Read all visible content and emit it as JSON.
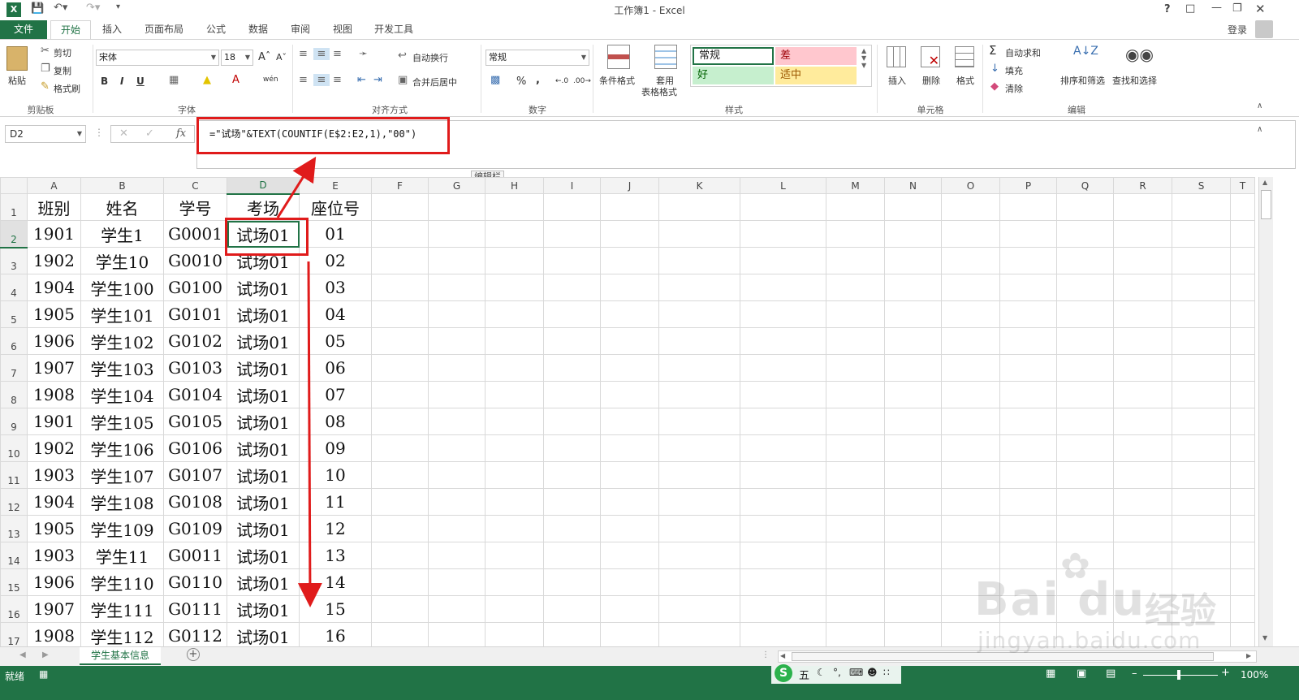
{
  "window": {
    "title": "工作簿1 - Excel",
    "help": "?",
    "sign_in": "登录",
    "undo_icon": "undo-icon",
    "redo_icon": "redo-icon"
  },
  "tabs": [
    "文件",
    "开始",
    "插入",
    "页面布局",
    "公式",
    "数据",
    "审阅",
    "视图",
    "开发工具"
  ],
  "active_tab": "开始",
  "ribbon": {
    "clipboard": {
      "paste": "粘贴",
      "cut": "剪切",
      "copy": "复制",
      "format_painter": "格式刷",
      "group": "剪贴板"
    },
    "font": {
      "name": "宋体",
      "size": "18",
      "bold": "B",
      "italic": "I",
      "underline": "U",
      "font_color": "A",
      "phonetic": "wén",
      "group": "字体"
    },
    "alignment": {
      "wrap": "自动换行",
      "merge": "合并后居中",
      "group": "对齐方式"
    },
    "number": {
      "format": "常规",
      "percent": "%",
      "comma": ",",
      "group": "数字"
    },
    "styles": {
      "conditional": "条件格式",
      "table_top": "套用",
      "table_bottom": "表格格式",
      "normal": "常规",
      "bad": "差",
      "good": "好",
      "neutral": "适中",
      "group": "样式"
    },
    "cells": {
      "insert": "插入",
      "delete": "删除",
      "format": "格式",
      "group": "单元格"
    },
    "editing": {
      "autosum": "自动求和",
      "fill": "填充",
      "clear": "清除",
      "sort": "排序和筛选",
      "find": "查找和选择",
      "group": "编辑"
    }
  },
  "formula_bar": {
    "name_box": "D2",
    "formula": "=\"试场\"&TEXT(COUNTIF(E$2:E2,1),\"00\")",
    "tooltip": "编辑栏"
  },
  "columns": [
    "A",
    "B",
    "C",
    "D",
    "E",
    "F",
    "G",
    "H",
    "I",
    "J",
    "K",
    "L",
    "M",
    "N",
    "O",
    "P",
    "Q",
    "R",
    "S",
    "T"
  ],
  "selected_cell": "D2",
  "rows": [
    {
      "n": "1",
      "cells": [
        "班别",
        "姓名",
        "学号",
        "考场",
        "座位号"
      ]
    },
    {
      "n": "2",
      "cells": [
        "1901",
        "学生1",
        "G0001",
        "试场01",
        "01"
      ]
    },
    {
      "n": "3",
      "cells": [
        "1902",
        "学生10",
        "G0010",
        "试场01",
        "02"
      ]
    },
    {
      "n": "4",
      "cells": [
        "1904",
        "学生100",
        "G0100",
        "试场01",
        "03"
      ]
    },
    {
      "n": "5",
      "cells": [
        "1905",
        "学生101",
        "G0101",
        "试场01",
        "04"
      ]
    },
    {
      "n": "6",
      "cells": [
        "1906",
        "学生102",
        "G0102",
        "试场01",
        "05"
      ]
    },
    {
      "n": "7",
      "cells": [
        "1907",
        "学生103",
        "G0103",
        "试场01",
        "06"
      ]
    },
    {
      "n": "8",
      "cells": [
        "1908",
        "学生104",
        "G0104",
        "试场01",
        "07"
      ]
    },
    {
      "n": "9",
      "cells": [
        "1901",
        "学生105",
        "G0105",
        "试场01",
        "08"
      ]
    },
    {
      "n": "10",
      "cells": [
        "1902",
        "学生106",
        "G0106",
        "试场01",
        "09"
      ]
    },
    {
      "n": "11",
      "cells": [
        "1903",
        "学生107",
        "G0107",
        "试场01",
        "10"
      ]
    },
    {
      "n": "12",
      "cells": [
        "1904",
        "学生108",
        "G0108",
        "试场01",
        "11"
      ]
    },
    {
      "n": "13",
      "cells": [
        "1905",
        "学生109",
        "G0109",
        "试场01",
        "12"
      ]
    },
    {
      "n": "14",
      "cells": [
        "1903",
        "学生11",
        "G0011",
        "试场01",
        "13"
      ]
    },
    {
      "n": "15",
      "cells": [
        "1906",
        "学生110",
        "G0110",
        "试场01",
        "14"
      ]
    },
    {
      "n": "16",
      "cells": [
        "1907",
        "学生111",
        "G0111",
        "试场01",
        "15"
      ]
    },
    {
      "n": "17",
      "cells": [
        "1908",
        "学生112",
        "G0112",
        "试场01",
        "16"
      ]
    }
  ],
  "sheet_tab": "学生基本信息",
  "status": {
    "ready": "就绪",
    "zoom": "100%",
    "ime_mode": "五"
  },
  "watermark": {
    "brand": "Bai  du",
    "cn": "经验",
    "url": "jingyan.baidu.com"
  },
  "colors": {
    "excel_green": "#217346",
    "annotation_red": "#e01b1b",
    "bad_fill": "#ffc7ce",
    "good_fill": "#c6efce",
    "neutral_fill": "#ffeb9c"
  }
}
